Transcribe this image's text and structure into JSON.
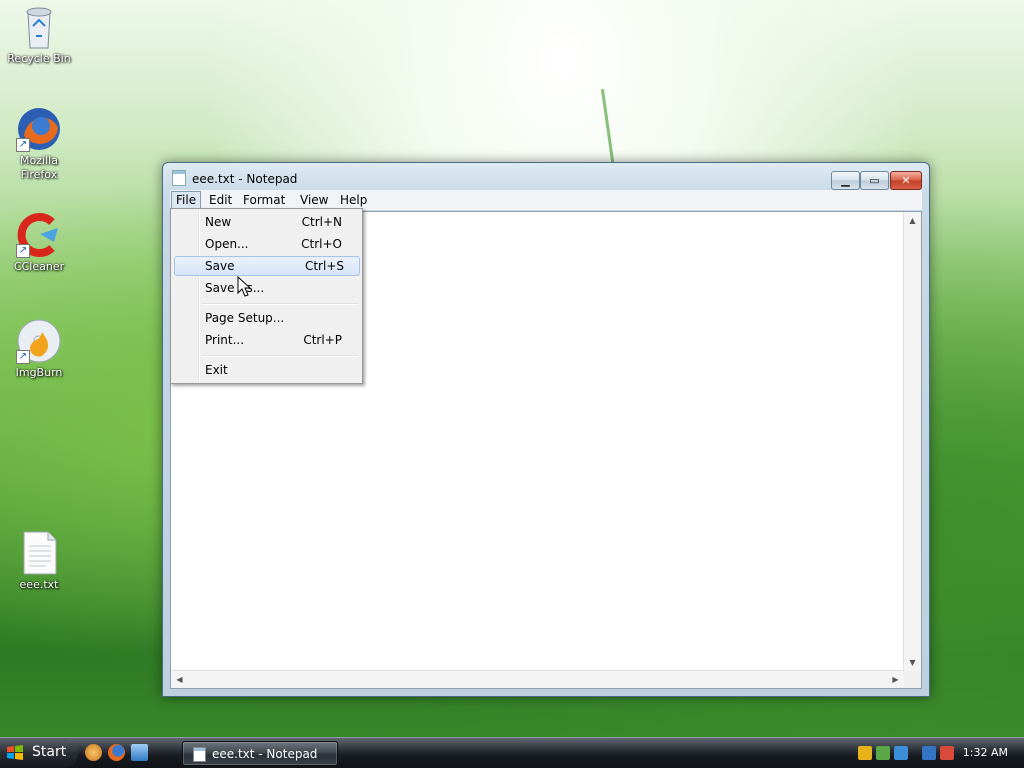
{
  "desktop": {
    "icons": [
      {
        "label": "Recycle Bin"
      },
      {
        "label": "Mozilla Firefox"
      },
      {
        "label": "CCleaner"
      },
      {
        "label": "ImgBurn"
      },
      {
        "label": "eee.txt"
      }
    ]
  },
  "window": {
    "title": "eee.txt - Notepad",
    "controls": {
      "minimize": "minimize-icon",
      "maximize": "maximize-icon",
      "close": "close-icon"
    },
    "menu": [
      {
        "label": "File",
        "active": true
      },
      {
        "label": "Edit"
      },
      {
        "label": "Format"
      },
      {
        "label": "View"
      },
      {
        "label": "Help"
      }
    ],
    "content": ""
  },
  "file_menu": {
    "items": [
      {
        "label": "New",
        "shortcut": "Ctrl+N"
      },
      {
        "label": "Open...",
        "shortcut": "Ctrl+O"
      },
      {
        "label": "Save",
        "shortcut": "Ctrl+S",
        "highlighted": true
      },
      {
        "label": "Save As...",
        "shortcut": ""
      },
      {
        "label": "Page Setup...",
        "shortcut": ""
      },
      {
        "label": "Print...",
        "shortcut": "Ctrl+P"
      },
      {
        "label": "Exit",
        "shortcut": ""
      }
    ]
  },
  "taskbar": {
    "start_label": "Start",
    "task_label": "eee.txt - Notepad",
    "clock": "1:32 AM"
  },
  "colors": {
    "menu_highlight": "#d6e5f7",
    "close_button": "#c33e25"
  }
}
